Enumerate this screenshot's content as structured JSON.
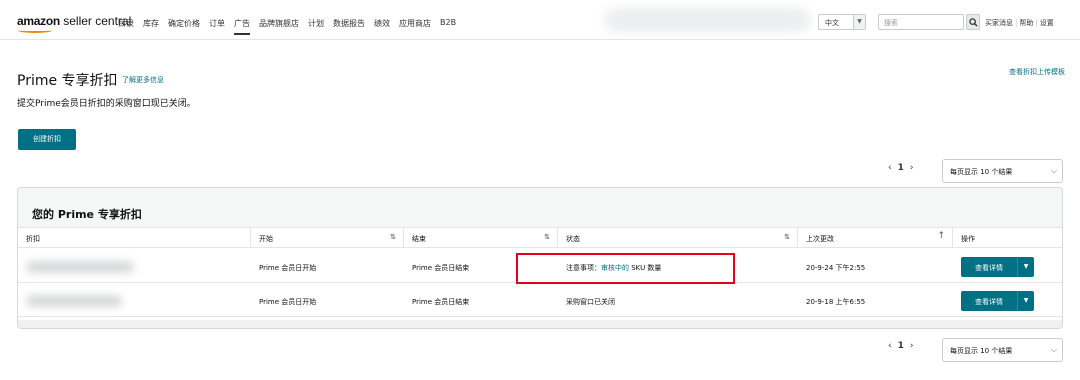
{
  "header": {
    "logo_bold": "amazon",
    "logo_rest": " seller central",
    "nav": [
      "目录",
      "库存",
      "确定价格",
      "订单",
      "广告",
      "品牌旗舰店",
      "计划",
      "数据报告",
      "绩效",
      "应用商店",
      "B2B"
    ],
    "active_nav": "广告",
    "language": "中文",
    "search_placeholder": "搜索",
    "links": [
      "买家消息",
      "帮助",
      "设置"
    ]
  },
  "page": {
    "title": "Prime 专享折扣",
    "learn_more": "了解更多信息",
    "notice": "提交Prime会员日折扣的采购窗口现已关闭。",
    "upload_template_link": "查看折扣上传模板",
    "create_button": "创建折扣"
  },
  "pagination": {
    "current_page": "1",
    "prev": "‹",
    "next": "›",
    "per_page": "每页显示 10 个结果"
  },
  "table": {
    "title": "您的 Prime 专享折扣",
    "columns": [
      "折扣",
      "开始",
      "结束",
      "状态",
      "上次更改",
      "操作"
    ],
    "rows": [
      {
        "discount": "",
        "start": "Prime 会员日开始",
        "end": "Prime 会员日结束",
        "status_prefix": "注意事项：",
        "status_link": "审核中的",
        "status_suffix": " SKU 数量",
        "last_modified": "20-9-24 下午2:55",
        "action": "查看详情"
      },
      {
        "discount": "",
        "start": "Prime 会员日开始",
        "end": "Prime 会员日结束",
        "status_prefix": "采购窗口已关闭",
        "status_link": "",
        "status_suffix": "",
        "last_modified": "20-9-18 上午6:55",
        "action": "查看详情"
      }
    ]
  },
  "colors": {
    "accent": "#007185",
    "highlight": "#e4001f",
    "logo_smile": "#f08804"
  }
}
